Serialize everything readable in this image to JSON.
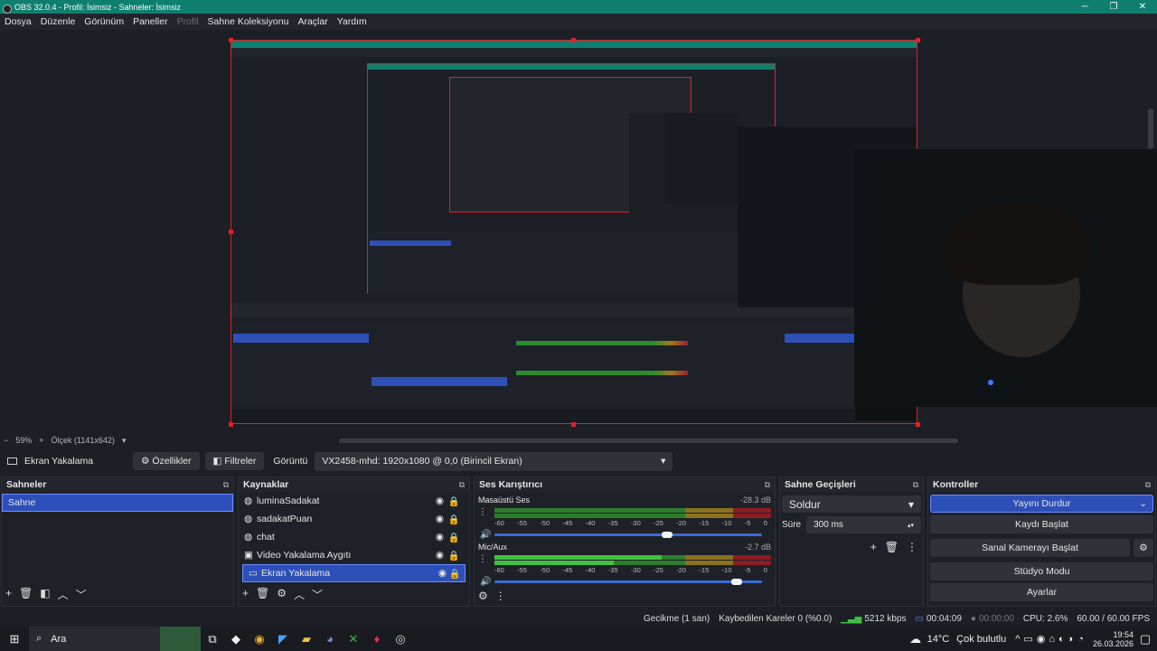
{
  "window": {
    "title": "OBS 32.0.4 - Profil: İsimsiz - Sahneler: İsimsiz",
    "minimize": "─",
    "restore": "❐",
    "close": "✕"
  },
  "menu": [
    "Dosya",
    "Düzenle",
    "Görünüm",
    "Paneller",
    "Profil",
    "Sahne Koleksiyonu",
    "Araçlar",
    "Yardım"
  ],
  "zoom": {
    "percent": "59%",
    "scale": "Ölçek (1141x642)",
    "minus": "−",
    "plus": "+"
  },
  "source_bar": {
    "source": "Ekran Yakalama",
    "properties": "Özellikler",
    "filters": "Filtreler",
    "display_label": "Görüntü",
    "display_value": "VX2458-mhd: 1920x1080 @ 0,0 (Birincil Ekran)"
  },
  "scenes": {
    "title": "Sahneler",
    "items": [
      "Sahne"
    ]
  },
  "sources": {
    "title": "Kaynaklar",
    "items": [
      "luminaSadakat",
      "sadakatPuan",
      "chat",
      "Video Yakalama Aygıtı",
      "Ekran Yakalama"
    ]
  },
  "mixer": {
    "title": "Ses Karıştırıcı",
    "channels": [
      {
        "name": "Masaüstü Ses",
        "db": "-28.3 dB",
        "level": 0.64
      },
      {
        "name": "Mic/Aux",
        "db": "-2.7 dB",
        "level": 0.9
      }
    ],
    "ticks": [
      "-60",
      "-55",
      "-50",
      "-45",
      "-40",
      "-35",
      "-30",
      "-25",
      "-20",
      "-15",
      "-10",
      "-5",
      "0"
    ]
  },
  "transitions": {
    "title": "Sahne Geçişleri",
    "type": "Soldur",
    "duration_label": "Süre",
    "duration": "300 ms"
  },
  "controls": {
    "title": "Kontroller",
    "buttons": [
      "Yayını Durdur",
      "Kaydı Başlat",
      "Sanal Kamerayı Başlat",
      "Stüdyo Modu",
      "Ayarlar"
    ]
  },
  "status": {
    "delay": "Gecikme (1 san)",
    "dropped": "Kaybedilen Kareler 0 (%0.0)",
    "bitrate": "5212 kbps",
    "stream_time": "00:04:09",
    "rec_time": "00:00:00",
    "cpu": "CPU: 2.6%",
    "fps": "60.00 / 60.00 FPS"
  },
  "taskbar": {
    "search": "Ara",
    "weather": "14°C",
    "weather_text": "Çok bulutlu",
    "time": "19:54",
    "date": "26.03.2026"
  },
  "colors": {
    "accent": "#2d50b8",
    "title_bar": "#0f7f6f",
    "selection_border": "#e0202a"
  }
}
